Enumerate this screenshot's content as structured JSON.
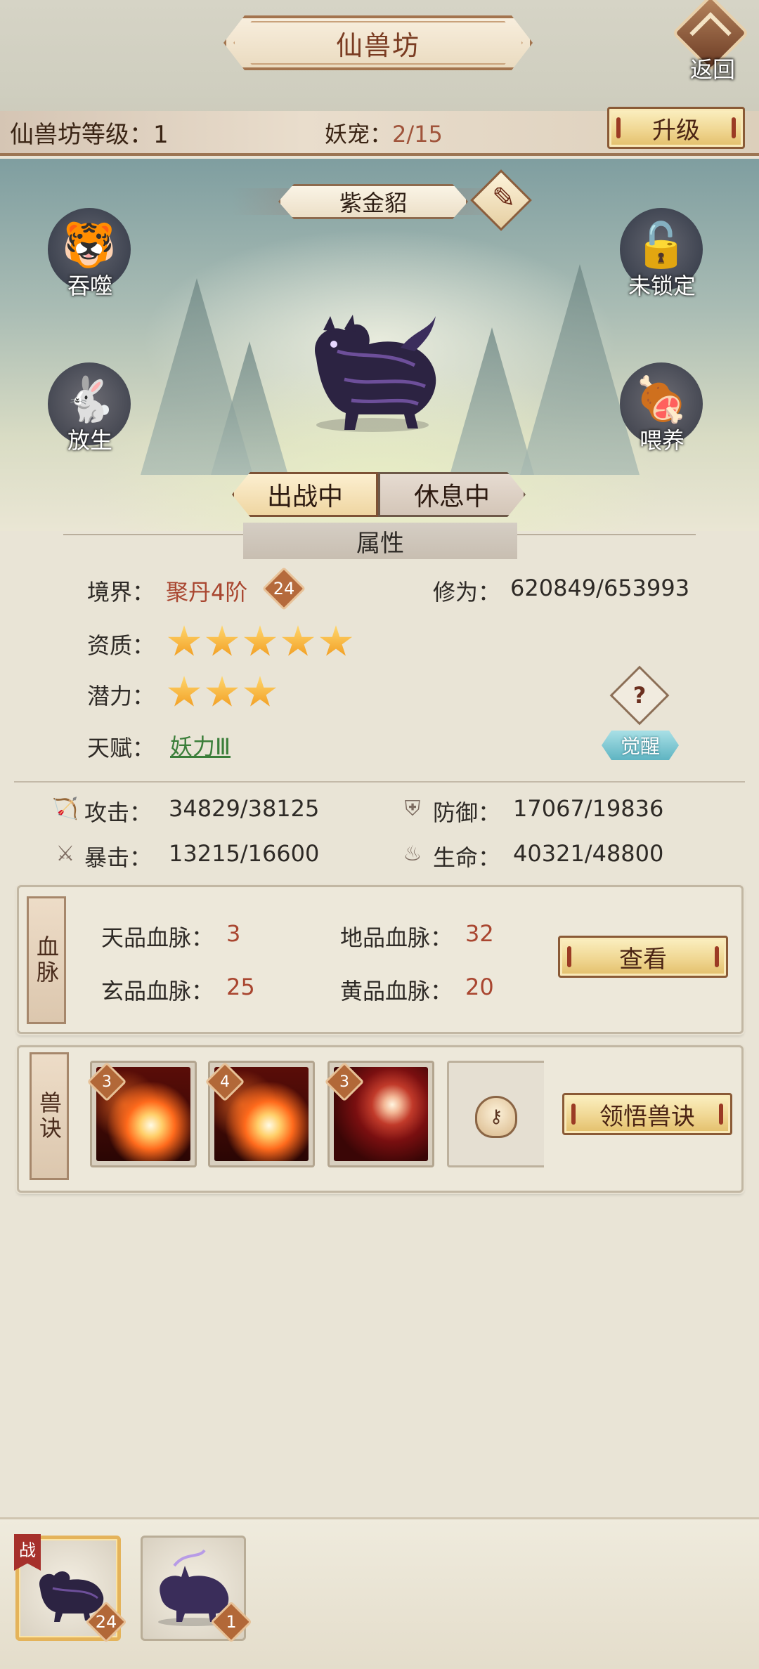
{
  "header": {
    "title": "仙兽坊",
    "back_label": "返回"
  },
  "level_bar": {
    "level_label": "仙兽坊等级：",
    "level_value": "1",
    "pet_label": "妖宠：",
    "pet_count": "2/15",
    "upgrade_label": "升级"
  },
  "pet": {
    "name": "紫金貂",
    "actions": {
      "devour": "吞噬",
      "release": "放生",
      "lock": "未锁定",
      "feed": "喂养"
    },
    "tabs": {
      "deployed": "出战中",
      "resting": "休息中"
    }
  },
  "attributes": {
    "section_title": "属性",
    "realm_label": "境界：",
    "realm_value": "聚丹4阶",
    "realm_badge": "24",
    "cultivation_label": "修为：",
    "cultivation_value": "620849/653993",
    "aptitude_label": "资质：",
    "aptitude_stars": 5,
    "potential_label": "潜力：",
    "potential_stars": 3,
    "talent_label": "天赋：",
    "talent_value": "妖力Ⅲ",
    "help_icon_text": "?",
    "awaken_label": "觉醒"
  },
  "stats": {
    "attack_label": "攻击：",
    "attack_value": "34829/38125",
    "defense_label": "防御：",
    "defense_value": "17067/19836",
    "crit_label": "暴击：",
    "crit_value": "13215/16600",
    "hp_label": "生命：",
    "hp_value": "40321/48800"
  },
  "bloodline": {
    "tab_label": "血脉",
    "heaven_label": "天品血脉：",
    "heaven_value": "3",
    "earth_label": "地品血脉：",
    "earth_value": "32",
    "mystic_label": "玄品血脉：",
    "mystic_value": "25",
    "yellow_label": "黄品血脉：",
    "yellow_value": "20",
    "view_label": "查看"
  },
  "skills": {
    "tab_label": "兽诀",
    "slots": [
      {
        "level": "3",
        "icon": "fire-claw-skill-icon"
      },
      {
        "level": "4",
        "icon": "fire-claw-skill-icon"
      },
      {
        "level": "3",
        "icon": "spiral-skill-icon"
      }
    ],
    "locked_icon": "lock-icon",
    "comprehend_label": "领悟兽诀"
  },
  "pet_bar": {
    "battle_flag": "战",
    "pets": [
      {
        "level": "24",
        "icon": "purple-marten-pet-icon",
        "selected": true
      },
      {
        "level": "1",
        "icon": "purple-rhino-pet-icon",
        "selected": false
      }
    ]
  },
  "colors": {
    "accent_red": "#a94630",
    "talent_green": "#3b7e3a",
    "gold_button": "#f0d793"
  }
}
